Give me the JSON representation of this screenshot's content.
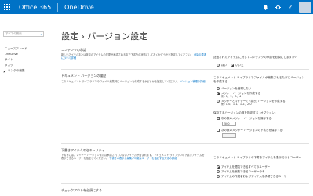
{
  "topbar": {
    "o365": "Office 365",
    "app": "OneDrive",
    "avatar_initial": "",
    "colors": {
      "bar": "#0072c6"
    }
  },
  "left_nav": {
    "search_placeholder": "すべての検索",
    "items": [
      "ニュースフィード",
      "OneDrive",
      "サイト",
      "タスク"
    ],
    "edit_links": "リンクの編集"
  },
  "page": {
    "title": "設定 › バージョン設定"
  },
  "content_approval": {
    "title": "コンテンツの承認",
    "desc": "新しいアイテムまたは既存のアイテムの変更が承認されるまで下書きの状態にしておくかどうかを指定してください。",
    "link": "承認の要求について詳細"
  },
  "doc_history": {
    "title": "ドキュメント バージョンの履歴",
    "desc": "このドキュメント ライブラリでのファイル編集時にバージョンを作成するかどうかを指定してください。",
    "link": "バージョン管理の詳細"
  },
  "draft_security": {
    "title": "下書きアイテムのセキュリティ",
    "desc": "下書きには、マイナー バージョンまたは承認されていないアイテムが含まれます。ドキュメント ライブラリの下書きアイテムを表示できるユーザーを指定してください。",
    "link": "下書きの表示と編集が可能なユーザーを指定する方法の詳細"
  },
  "checkout": {
    "title": "チェックアウトを必須にする"
  },
  "right": {
    "approval_q": "送信されたアイテムに対してコンテンツの承認を必須にしますか?",
    "approval_yes": "はい",
    "approval_no": "いいえ",
    "version_q": "このドキュメント ライブラリでファイルが編集されるたびにバージョンを作成する",
    "v_none": "バージョンを管理しない",
    "v_major": "メジャー バージョンを作成する",
    "v_major_ex": "例: 1、2、3、4",
    "v_minor": "メジャーとマイナー (下書き) バージョンを作成する",
    "v_minor_ex": "例: 1.0、1.1、1.2、2.0",
    "keep_q": "保存するバージョンの数を指定する (オプション)",
    "keep_major": "次の数のメジャー バージョンを保存する:",
    "keep_major_value": "500",
    "keep_drafts": "次の数のメジャー バージョンの下書きを保存する:",
    "draft_q": "このドキュメント ライブラリの下書きアイテムを表示できるユーザー",
    "d_any": "アイテムを閲覧できるすべてのユーザー",
    "d_edit": "アイテムを編集できるユーザーのみ",
    "d_approve": "アイテムの作成者およびアイテムを承認できるユーザー"
  }
}
